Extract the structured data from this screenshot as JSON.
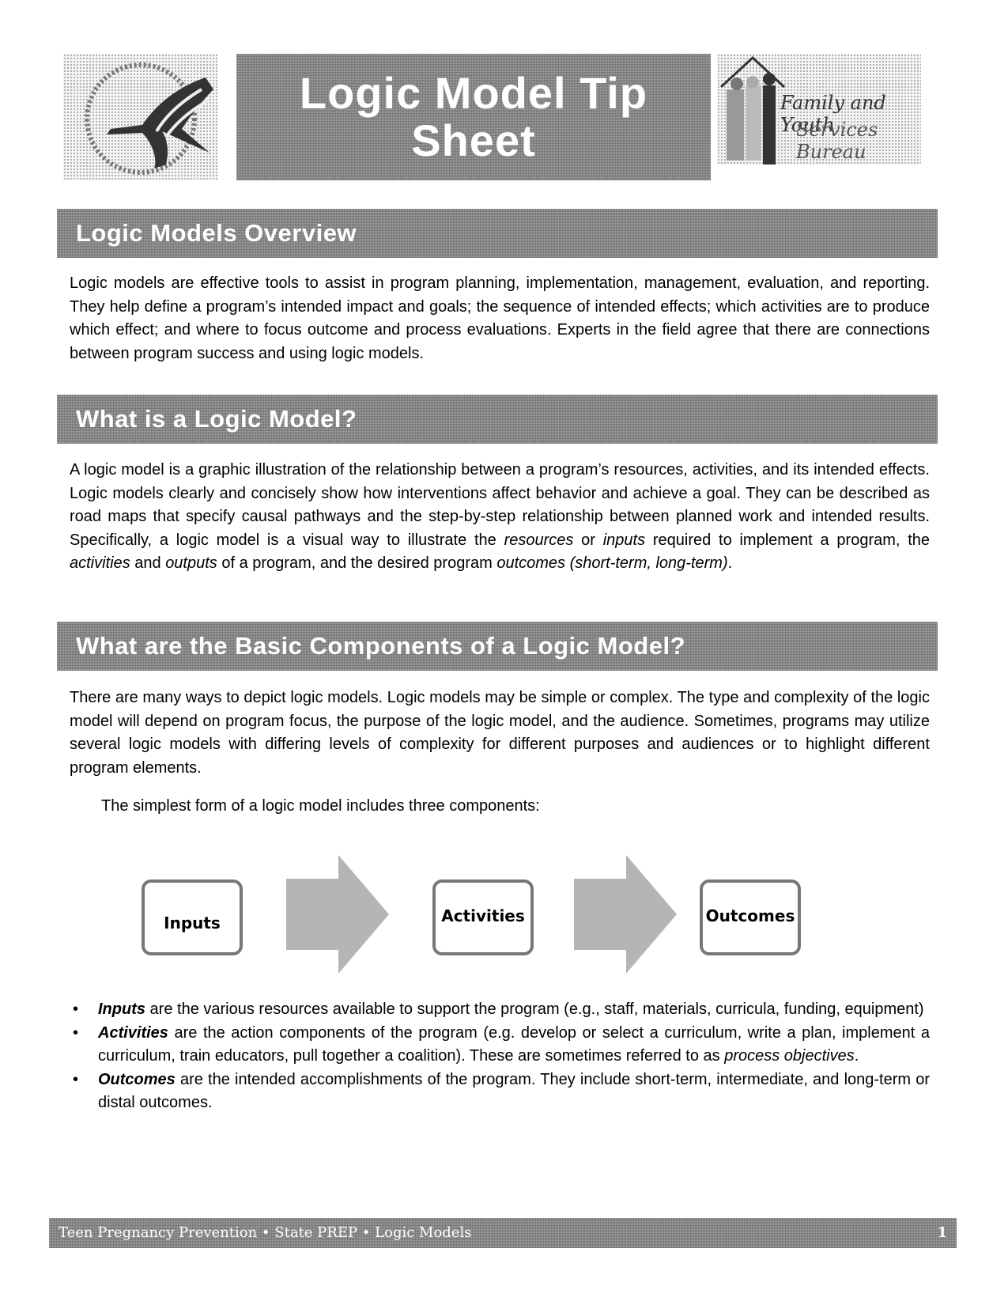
{
  "header": {
    "left_logo": "hhs-eagle-seal-icon",
    "title_line1": "Logic Model Tip",
    "title_line2": "Sheet",
    "right_logo_line1": "Family and Youth",
    "right_logo_line2": "Services Bureau"
  },
  "sections": [
    {
      "heading": "Logic Models Overview",
      "body": "Logic models are effective tools to assist in program planning, implementation, management, evaluation, and reporting. They help define a program’s intended impact and goals; the sequence of intended effects; which activities are to produce which effect; and where to focus outcome and process evaluations. Experts in the field agree that there are connections between program success and using logic models."
    },
    {
      "heading": "What is a Logic Model?",
      "body_parts": [
        "A logic model is a graphic illustration of the relationship between a program’s resources, activities, and its intended effects. Logic models clearly and concisely show how interventions affect behavior and achieve a goal. They can be described as road maps that specify causal pathways and the step-by-step relationship between planned work and intended results. Specifically, a logic model is a visual way to illustrate the ",
        "resources",
        " or ",
        "inputs",
        " required to implement a program, the ",
        "activities",
        " and ",
        "outputs",
        " of a program, and the desired program ",
        "outcomes (short-term, long-term)",
        "."
      ]
    },
    {
      "heading": "What are the Basic Components of a Logic Model?",
      "body": "There are many ways to depict logic models. Logic models may be simple or complex. The type and complexity of the logic model will depend on program focus, the purpose of the logic model, and the audience. Sometimes, programs may utilize several logic models with differing levels of complexity for different purposes and audiences or to highlight different program elements.",
      "intro": "The simplest form of a logic model includes three components:"
    }
  ],
  "diagram": {
    "components": [
      "Inputs",
      "Activities",
      "Outcomes"
    ],
    "arrow_icon": "right-arrow-icon"
  },
  "bullets": [
    {
      "term": "Inputs",
      "text": " are the various resources available to support the program (e.g., staff, materials, curricula, funding, equipment)"
    },
    {
      "term": "Activities",
      "text": " are the action components of the program (e.g. develop or select a curriculum, write a plan, implement a curriculum, train educators, pull together a coalition). These are sometimes referred to as ",
      "italic_tail": "process objectives",
      "tail_end": "."
    },
    {
      "term": "Outcomes",
      "text": " are the intended accomplishments of the program. They include short-term, intermediate, and long-term or distal outcomes."
    }
  ],
  "footer": {
    "text": "Teen Pregnancy Prevention • State PREP • Logic Models",
    "page_number": "1"
  }
}
